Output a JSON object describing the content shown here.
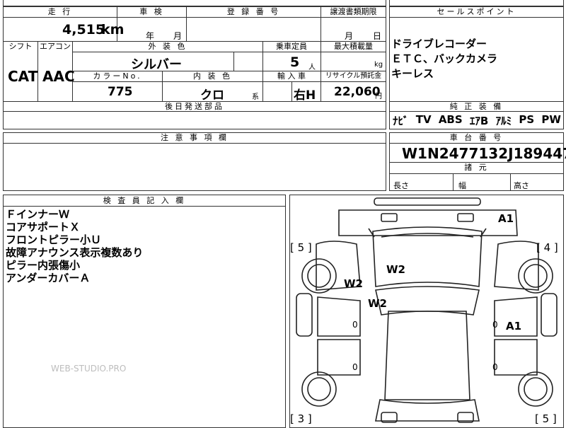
{
  "headers": {
    "mileage": "走 行",
    "inspection": "車 検",
    "registration": "登 録 番 号",
    "transfer_deadline": "譲渡書類期限",
    "selling_points": "セールスポイント",
    "shift": "シフト",
    "aircon": "エアコン",
    "exterior_color": "外 装 色",
    "capacity": "乗車定員",
    "max_load": "最大積載量",
    "color_no": "カラーNo.",
    "interior_color": "内 装 色",
    "import": "輸 入 車",
    "recycle": "リサイクル預託金",
    "later_parts": "後日発送部品",
    "equipment": "純 正 装 備",
    "notes": "注 意 事 項 欄",
    "chassis": "車 台 番 号",
    "dimensions": "諸 元",
    "inspector": "検 査 員 記 入 欄"
  },
  "values": {
    "mileage": "4,515",
    "mileage_unit": "km",
    "year_unit": "年",
    "month_unit": "月",
    "transfer_month_unit": "月",
    "transfer_day_unit": "日",
    "shift": "CAT",
    "aircon": "AAC",
    "exterior_color": "シルバー",
    "capacity": "5",
    "capacity_unit": "人",
    "max_load_unit": "kg",
    "color_no": "775",
    "interior_color": "クロ",
    "interior_suffix": "系",
    "import_box": "",
    "import_side": "右H",
    "recycle_amount": "22,060",
    "recycle_unit": "円",
    "chassis_number": "W1N2477132J189447",
    "length_label": "長さ",
    "width_label": "幅",
    "height_label": "高さ"
  },
  "selling_points": [
    "ドライブレコーダー",
    "ＥＴＣ、バックカメラ",
    "キーレス"
  ],
  "equipment": [
    "ﾅﾋﾞ",
    "TV",
    "ABS",
    "ｴｱB",
    "ｱﾙﾐ",
    "PS",
    "PW"
  ],
  "inspector_notes": [
    "ＦインナーＷ",
    "コアサポートＸ",
    "フロントピラー小Ｕ",
    "故障アナウンス表示複数あり",
    "ピラー内張傷小",
    "アンダーカバーＡ"
  ],
  "diagram": {
    "marks": {
      "a1_top": "A1",
      "a1_right": "A1",
      "w2_hood": "W2",
      "w2_left": "W2",
      "w2_windshield": "W2"
    },
    "tires": {
      "front_left": "[ 5 ]",
      "front_right": "[ 4 ]",
      "rear_left": "[ 3 ]",
      "rear_right": "[ 5 ]"
    },
    "zeros": [
      "0",
      "0",
      "0",
      "0"
    ]
  },
  "watermark": "WEB-STUDIO.PRO"
}
